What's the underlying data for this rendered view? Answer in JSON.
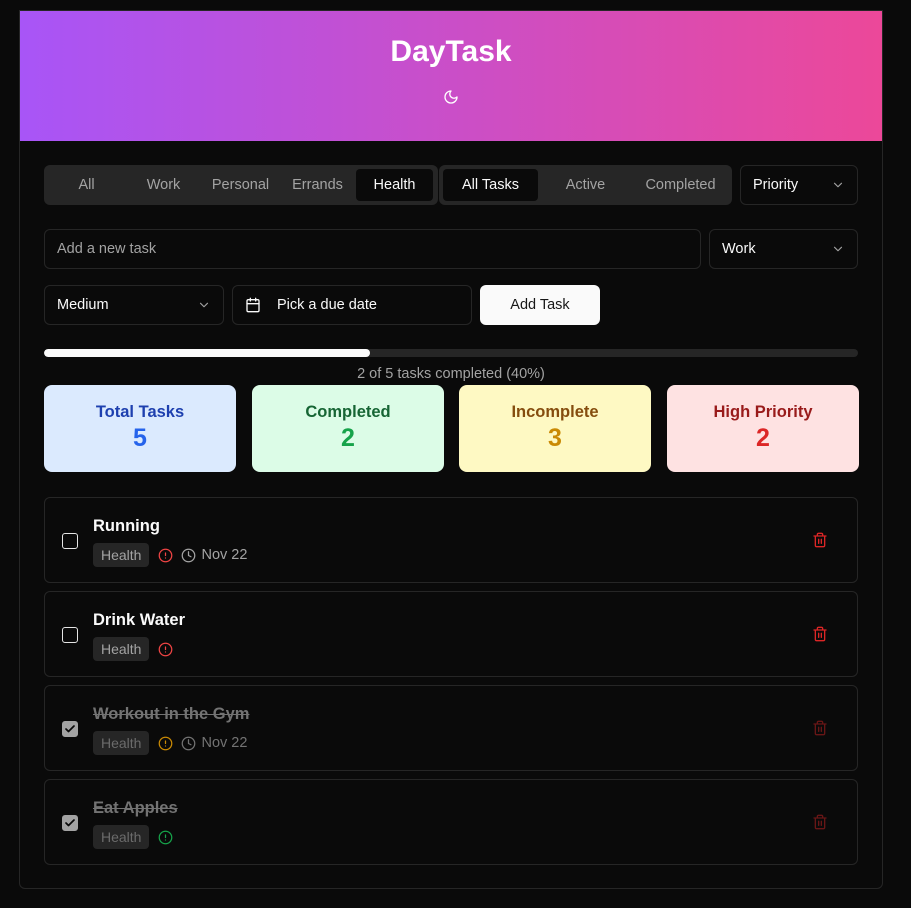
{
  "app": {
    "title": "DayTask"
  },
  "category_tabs": [
    "All",
    "Work",
    "Personal",
    "Errands",
    "Health"
  ],
  "category_active": "Health",
  "status_tabs": [
    "All Tasks",
    "Active",
    "Completed"
  ],
  "status_active": "All Tasks",
  "sort_select": {
    "value": "Priority"
  },
  "new_task": {
    "placeholder": "Add a new task",
    "category_value": "Work",
    "priority_value": "Medium",
    "due_placeholder": "Pick a due date",
    "add_label": "Add Task"
  },
  "progress": {
    "fraction": 0.4,
    "text": "2 of 5 tasks completed (40%)"
  },
  "stats": [
    {
      "label": "Total Tasks",
      "value": "5",
      "bg": "#dbeafe",
      "label_color": "#1e40af",
      "value_color": "#2563eb"
    },
    {
      "label": "Completed",
      "value": "2",
      "bg": "#dcfce7",
      "label_color": "#166534",
      "value_color": "#16a34a"
    },
    {
      "label": "Incomplete",
      "value": "3",
      "bg": "#fef9c3",
      "label_color": "#854d0e",
      "value_color": "#ca8a04"
    },
    {
      "label": "High Priority",
      "value": "2",
      "bg": "#fee2e2",
      "label_color": "#991b1b",
      "value_color": "#dc2626"
    }
  ],
  "tasks": [
    {
      "title": "Running",
      "category": "Health",
      "priority_icon": "alert-circle-icon",
      "priority_color": "#ef4444",
      "due": "Nov 22",
      "completed": false
    },
    {
      "title": "Drink Water",
      "category": "Health",
      "priority_icon": "alert-circle-icon",
      "priority_color": "#ef4444",
      "due": "",
      "completed": false
    },
    {
      "title": "Workout in the Gym",
      "category": "Health",
      "priority_icon": "alert-circle-icon",
      "priority_color": "#ca8a04",
      "due": "Nov 22",
      "completed": true
    },
    {
      "title": "Eat Apples",
      "category": "Health",
      "priority_icon": "alert-circle-icon",
      "priority_color": "#16a34a",
      "due": "",
      "completed": true
    }
  ],
  "colors": {
    "header_from": "#a855f7",
    "header_to": "#ec4899",
    "trash": "#dc2626"
  }
}
